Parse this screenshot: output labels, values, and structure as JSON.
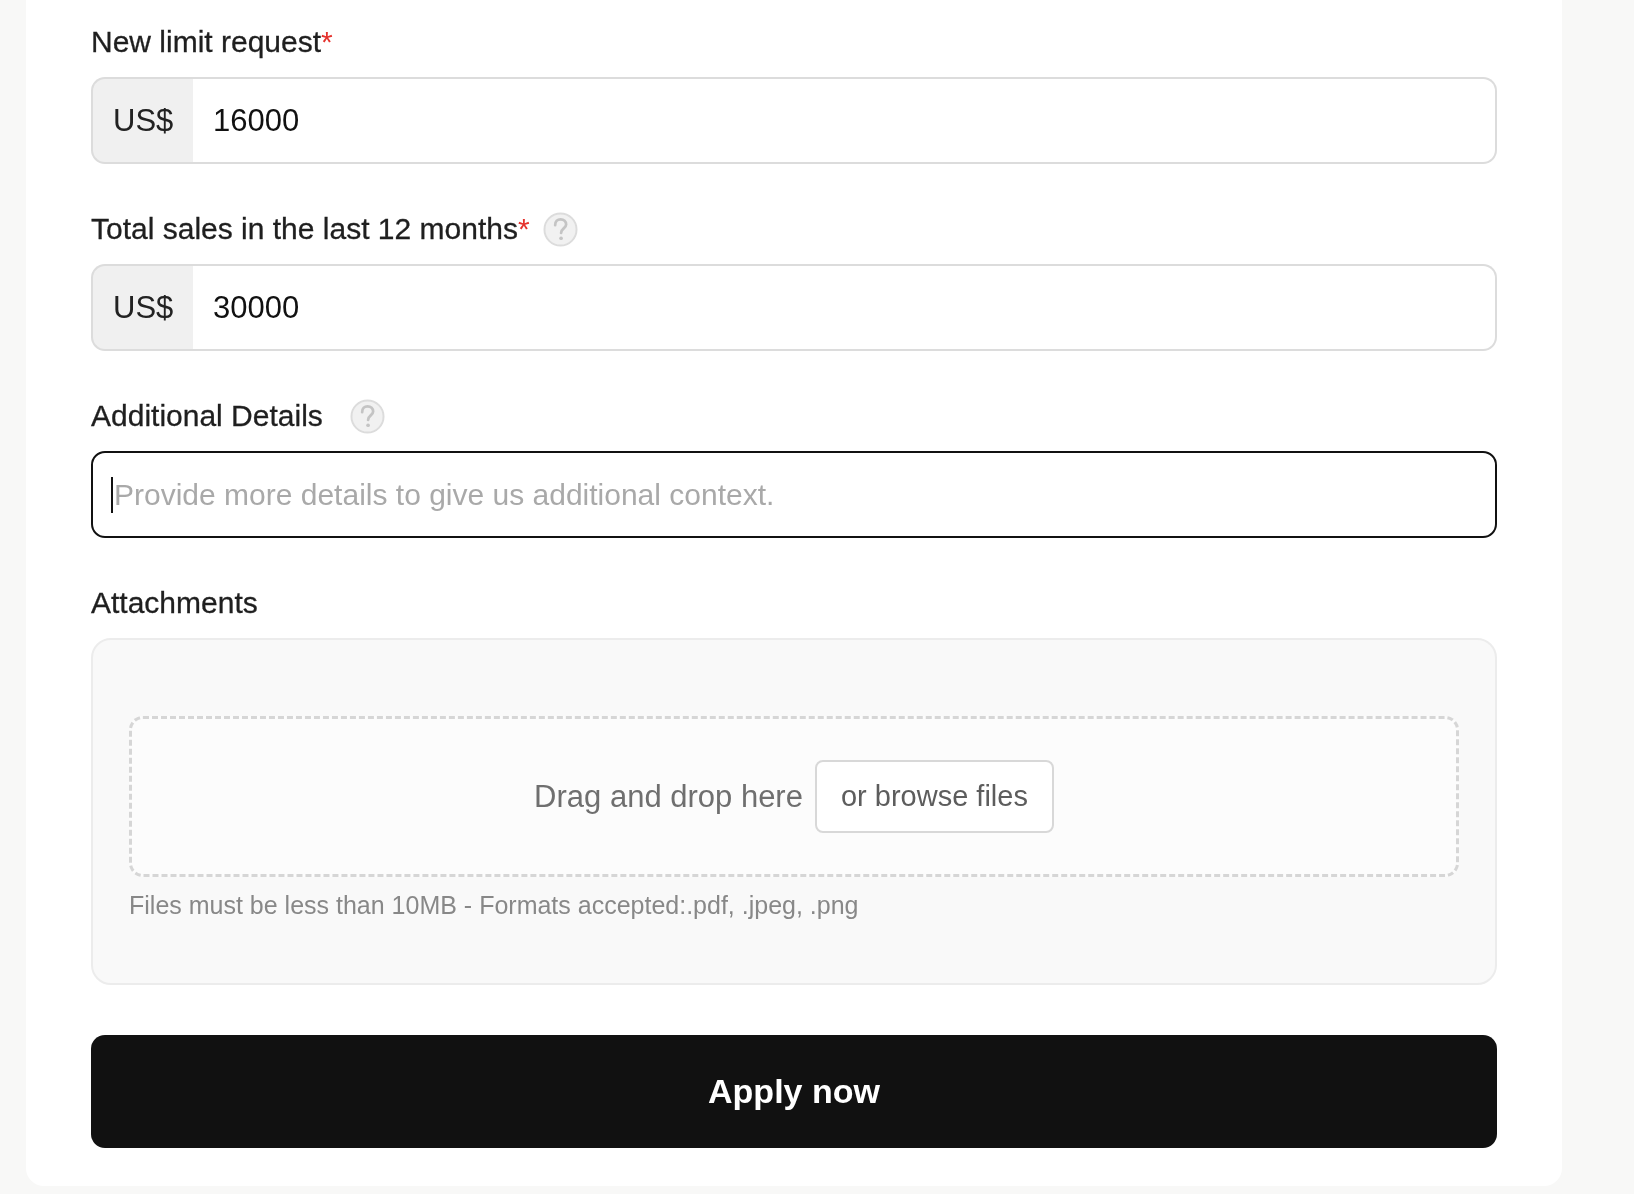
{
  "fields": [
    {
      "kind": "currency",
      "label": "New limit request",
      "required_mark": "*",
      "prefix": "US$",
      "value": "16000",
      "focused": false
    },
    {
      "kind": "currency",
      "label": "Total sales in the last 12 months",
      "required_mark": "*",
      "help": true,
      "prefix": "US$",
      "value": "30000",
      "focused": false
    },
    {
      "kind": "text",
      "label": "Additional Details",
      "help": true,
      "placeholder": "Provide more details to give us additional context.",
      "focused": true
    },
    {
      "kind": "attachments",
      "label": "Attachments",
      "drop_text": "Drag and drop here",
      "browse_button": "or browse files",
      "hint": "Files must be less than 10MB - Formats accepted:.pdf, .jpeg, .png"
    }
  ],
  "submit_button": "Apply now"
}
